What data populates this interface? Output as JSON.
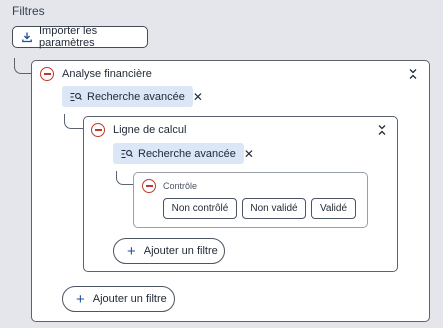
{
  "page": {
    "title": "Filtres",
    "import_button": {
      "label": "Importer les paramètres",
      "icon": "download-icon"
    }
  },
  "colors": {
    "remove": "#c0392b",
    "chip_bg": "#dbe6f7",
    "accent": "#1d4f9a",
    "background": "#e4e6ec"
  },
  "group1": {
    "label": "Analyse financière",
    "chip": {
      "label": "Recherche avancée",
      "icon": "advanced-search-icon",
      "close": "✕"
    },
    "add_button": "Ajouter un filtre"
  },
  "group2": {
    "label": "Ligne de calcul",
    "chip": {
      "label": "Recherche avancée",
      "icon": "advanced-search-icon",
      "close": "✕"
    },
    "add_button": "Ajouter un filtre"
  },
  "group3": {
    "label": "Contrôle",
    "options": [
      "Non contrôlé",
      "Non validé",
      "Validé"
    ]
  }
}
